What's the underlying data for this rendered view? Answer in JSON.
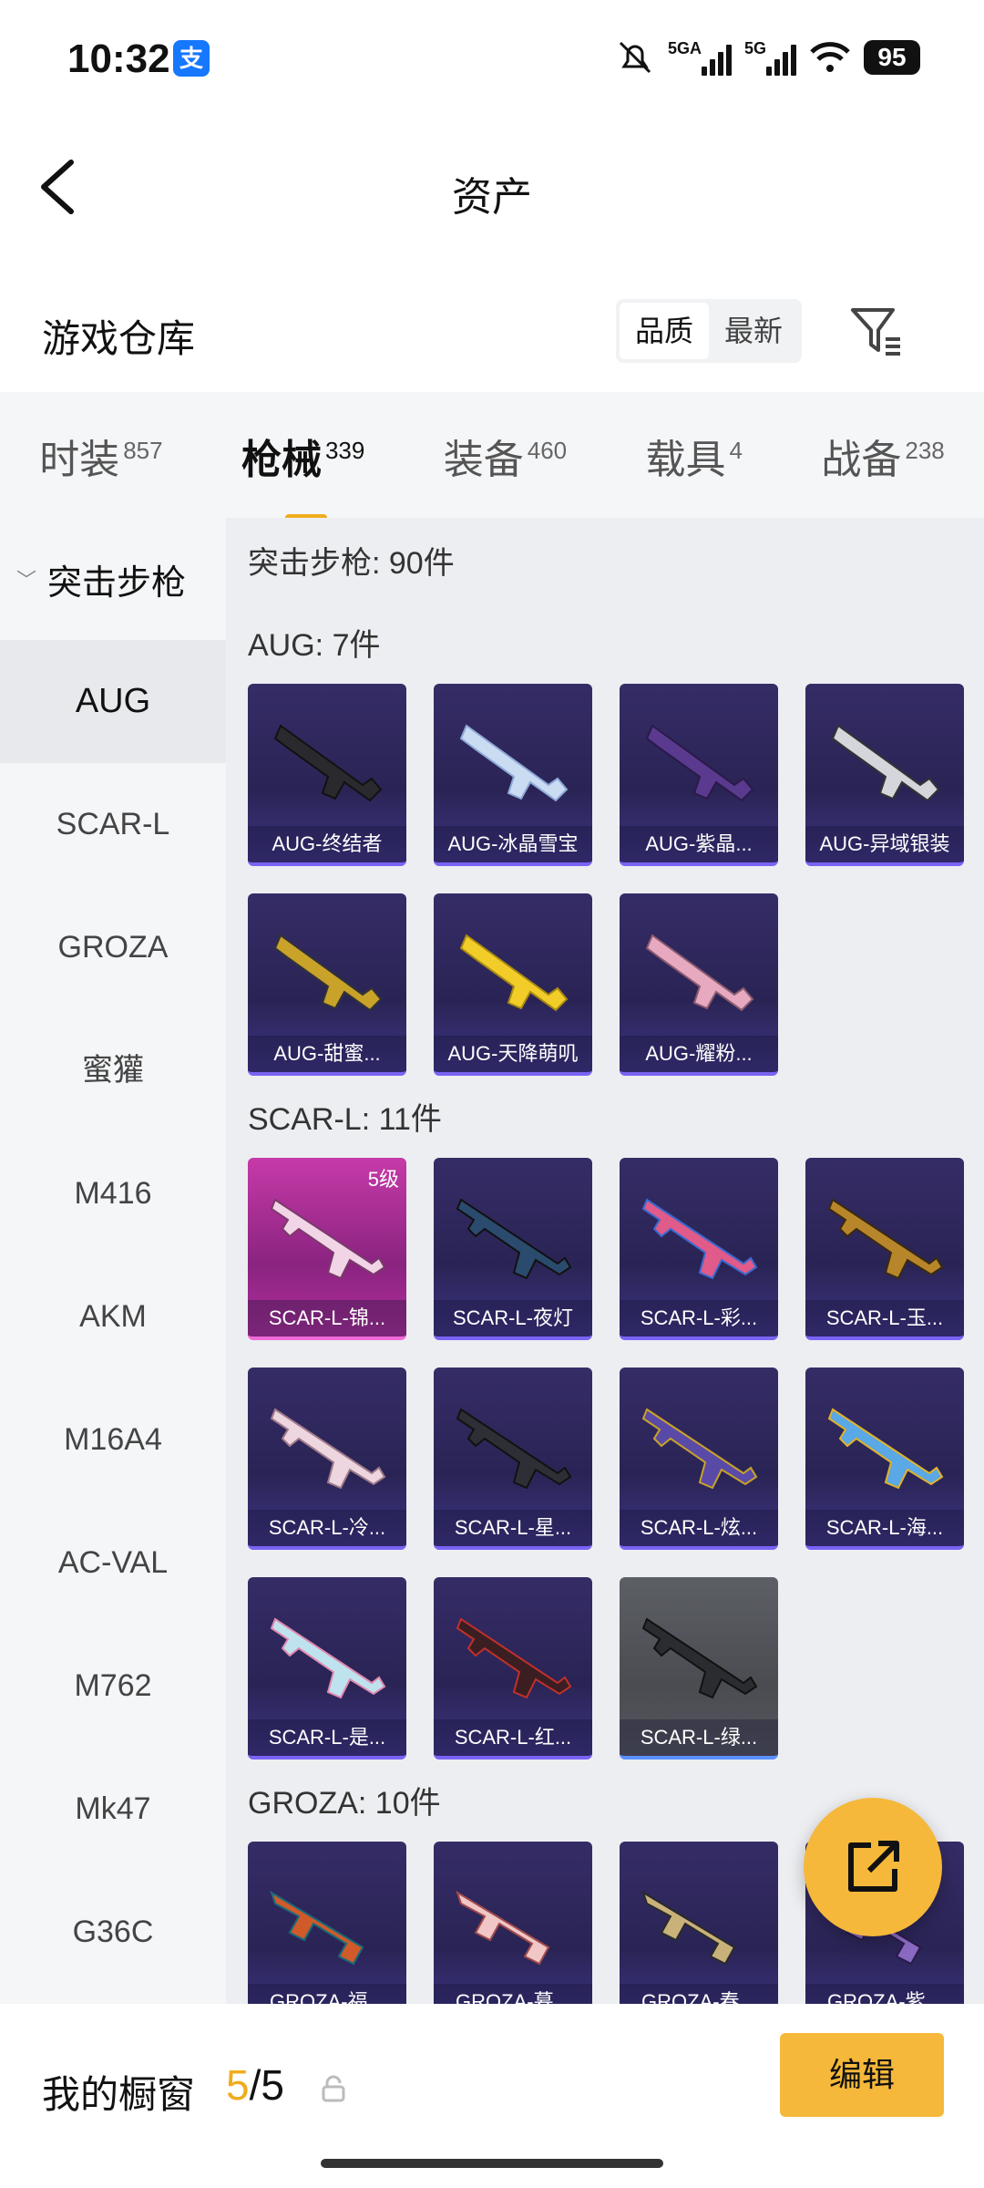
{
  "status": {
    "time": "10:32",
    "net1": "5GA",
    "net2": "5G",
    "battery": "95"
  },
  "nav": {
    "title": "资产"
  },
  "header": {
    "title": "游戏仓库",
    "sort": [
      "品质",
      "最新"
    ]
  },
  "tabs": [
    {
      "label": "时装",
      "count": "857"
    },
    {
      "label": "枪械",
      "count": "339"
    },
    {
      "label": "装备",
      "count": "460"
    },
    {
      "label": "载具",
      "count": "4"
    },
    {
      "label": "战备",
      "count": "238"
    }
  ],
  "sidebar": {
    "group": "突击步枪",
    "items": [
      "AUG",
      "SCAR-L",
      "GROZA",
      "蜜獾",
      "M416",
      "AKM",
      "M16A4",
      "AC-VAL",
      "M762",
      "Mk47",
      "G36C"
    ]
  },
  "content": {
    "summary": "突击步枪: 90件",
    "sections": [
      {
        "title": "AUG: 7件",
        "items": [
          "AUG-终结者",
          "AUG-冰晶雪宝",
          "AUG-紫晶...",
          "AUG-异域银装",
          "AUG-甜蜜...",
          "AUG-天降萌叽",
          "AUG-耀粉..."
        ]
      },
      {
        "title": "SCAR-L: 11件",
        "items": [
          "SCAR-L-锦...",
          "SCAR-L-夜灯",
          "SCAR-L-彩...",
          "SCAR-L-玉...",
          "SCAR-L-冷...",
          "SCAR-L-星...",
          "SCAR-L-炫...",
          "SCAR-L-海...",
          "SCAR-L-是...",
          "SCAR-L-红...",
          "SCAR-L-绿..."
        ],
        "level_badge": "5级"
      },
      {
        "title": "GROZA: 10件",
        "items": [
          "GROZA-福...",
          "GROZA-暮...",
          "GROZA-春...",
          "GROZA-紫..."
        ]
      }
    ]
  },
  "bottom": {
    "label": "我的橱窗",
    "count_current": "5",
    "count_total": "/5",
    "edit": "编辑"
  },
  "colors": {
    "accent": "#f5b83a",
    "tab_indicator": "#f0ac1c",
    "card_purple": "#352c66",
    "card_pink": "#c63aa8"
  }
}
